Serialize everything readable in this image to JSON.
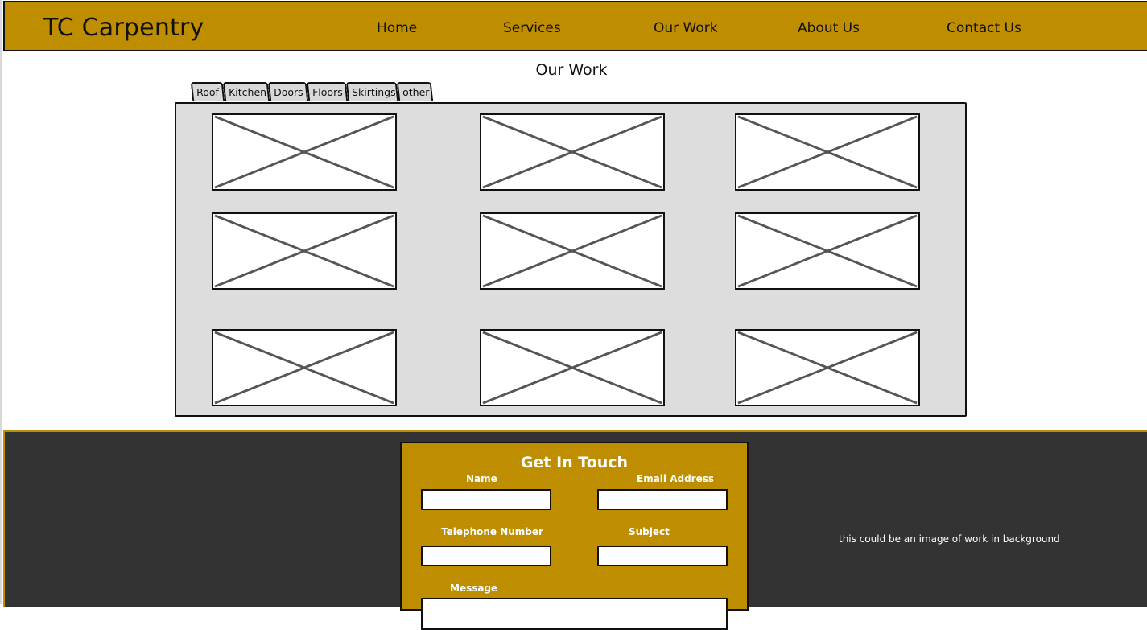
{
  "header": {
    "brand": "TC Carpentry",
    "nav": [
      "Home",
      "Services",
      "Our Work",
      "About Us",
      "Contact Us"
    ]
  },
  "page": {
    "title": "Our Work"
  },
  "tabs": [
    "Roof",
    "Kitchen",
    "Doors",
    "Floors",
    "Skirtings",
    "other"
  ],
  "gallery": {
    "count": 9
  },
  "contact": {
    "title": "Get In Touch",
    "name_label": "Name",
    "email_label": "Email Address",
    "phone_label": "Telephone Number",
    "subject_label": "Subject",
    "message_label": "Message"
  },
  "footer": {
    "note": "this could be an image of work in background"
  },
  "colors": {
    "accent": "#bf8e00",
    "footer_bg": "#333333",
    "gallery_bg": "#dddddd"
  }
}
